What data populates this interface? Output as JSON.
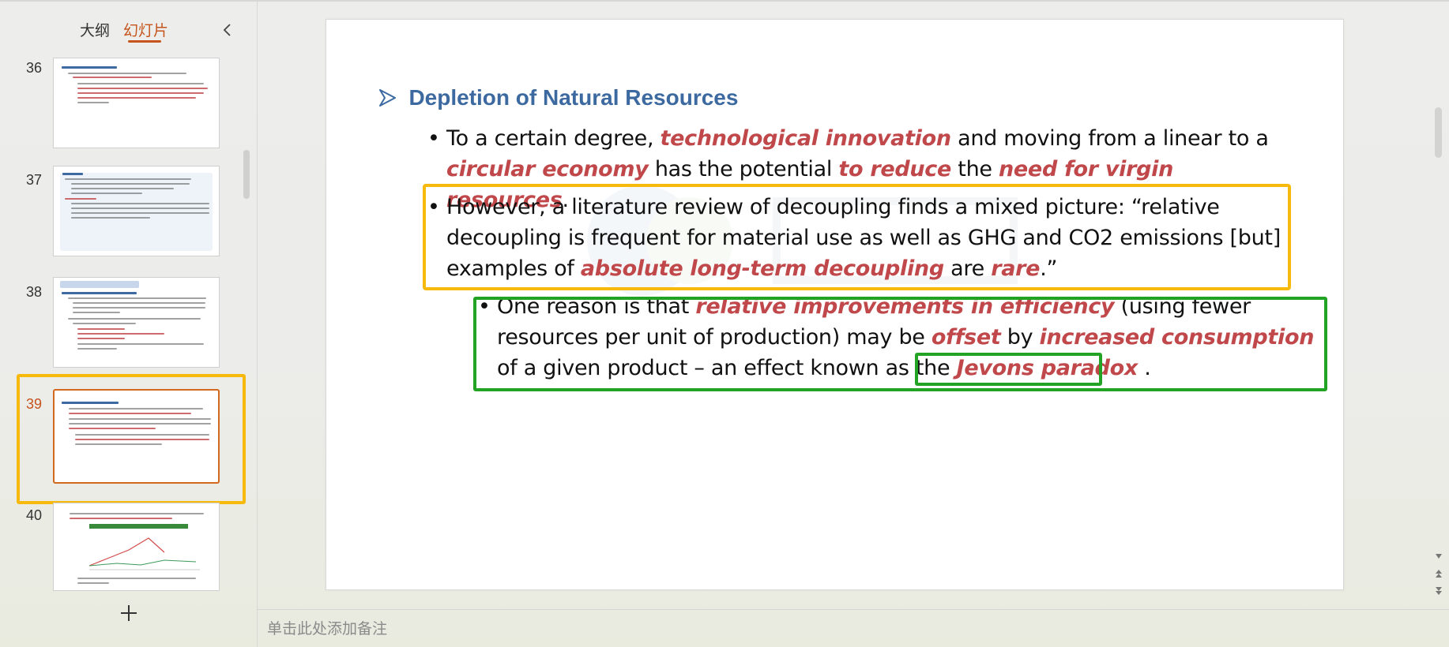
{
  "panel": {
    "tabs": [
      {
        "label": "大纲"
      },
      {
        "label": "幻灯片",
        "active": true
      }
    ],
    "collapse_icon": "chevron-left-icon",
    "add_slide_icon": "plus-icon"
  },
  "thumbnails": [
    {
      "number": "36"
    },
    {
      "number": "37"
    },
    {
      "number": "38"
    },
    {
      "number": "39",
      "active": true
    },
    {
      "number": "40"
    }
  ],
  "slide": {
    "title": "Depletion of Natural Resources",
    "bullets": [
      {
        "segments": [
          {
            "text": "To a certain degree, "
          },
          {
            "text": "technological innovation",
            "em": true
          },
          {
            "text": " and moving from a linear to a "
          },
          {
            "text": "circular economy",
            "em": true
          },
          {
            "text": " has the potential "
          },
          {
            "text": "to reduce",
            "em": true
          },
          {
            "text": " the "
          },
          {
            "text": "need for virgin resources",
            "em": true
          },
          {
            "text": "."
          }
        ]
      },
      {
        "segments": [
          {
            "text": "However, a literature review of decoupling finds a mixed picture: “relative decoupling is frequent for material use as well as GHG and CO2 emissions [but] examples of "
          },
          {
            "text": "absolute long-term decoupling",
            "em": true
          },
          {
            "text": " are "
          },
          {
            "text": "rare",
            "em": true
          },
          {
            "text": ".”"
          }
        ]
      },
      {
        "segments": [
          {
            "text": "One reason is that "
          },
          {
            "text": "relative improvements in efficiency",
            "em": true
          },
          {
            "text": " (using fewer resources per unit of production) may be "
          },
          {
            "text": "offset",
            "em": true
          },
          {
            "text": " by "
          },
          {
            "text": "increased consumption",
            "em": true
          },
          {
            "text": " of a given product – an effect known as the "
          },
          {
            "text": "Jevons paradox",
            "em": true
          },
          {
            "text": " ."
          }
        ]
      }
    ],
    "bullet_char": "•"
  },
  "notes_placeholder": "单击此处添加备注",
  "colors": {
    "accent": "#c5551d",
    "title_blue": "#3c6aa0",
    "emphasis_red": "#c0474a",
    "highlight_orange": "#f8b90d",
    "highlight_green": "#23a324"
  }
}
